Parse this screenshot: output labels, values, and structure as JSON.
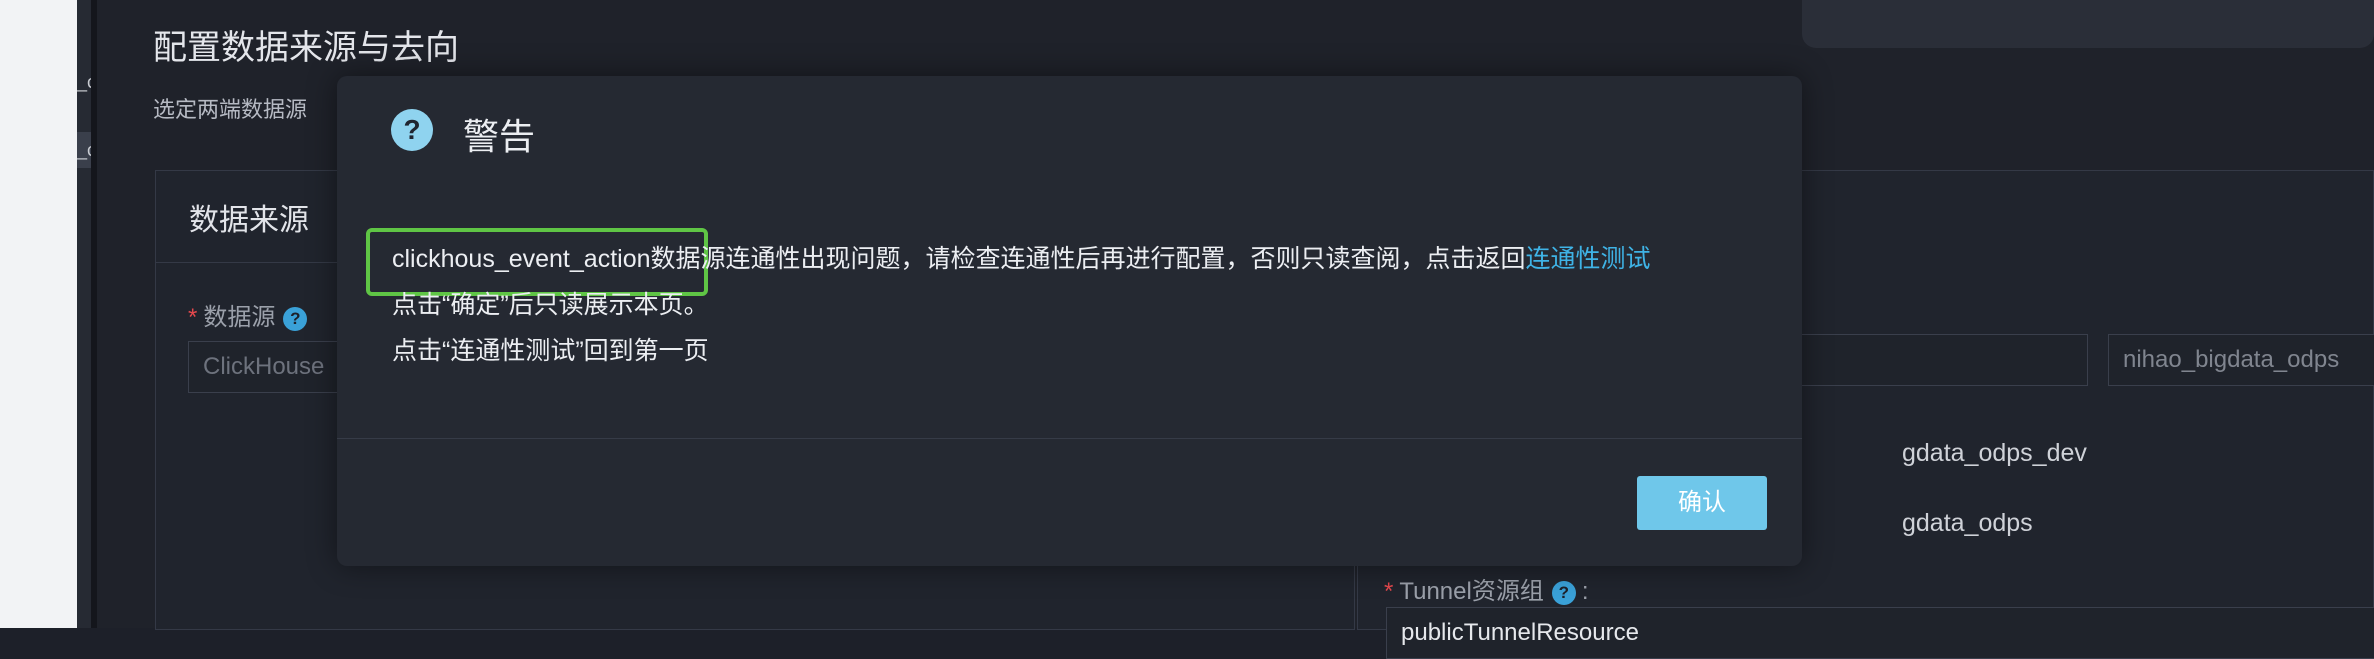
{
  "left_nav": {
    "items": [
      "_c",
      "_c"
    ]
  },
  "page": {
    "title": "配置数据来源与去向",
    "subtitle": "选定两端数据源"
  },
  "source_panel": {
    "title": "数据来源",
    "datasource_label": "数据源",
    "datasource_value": "ClickHouse"
  },
  "target_panel": {
    "datasource_value": "nihao_bigdata_odps",
    "option_1": "gdata_odps_dev",
    "option_2": "gdata_odps",
    "tunnel_label": "Tunnel资源组",
    "tunnel_value": "publicTunnelResource"
  },
  "modal": {
    "title": "警告",
    "icon": "question-circle-icon",
    "line1_text": "clickhous_event_action数据源连通性出现问题，请检查连通性后再进行配置，否则只读查阅，点击返回",
    "line1_link": "连通性测试",
    "line2": "点击“确定”后只读展示本页。",
    "line3": "点击“连通性测试”回到第一页",
    "confirm_label": "确认"
  },
  "colors": {
    "accent": "#3fb3e6",
    "highlight": "#5fc545",
    "required": "#e5484d"
  }
}
